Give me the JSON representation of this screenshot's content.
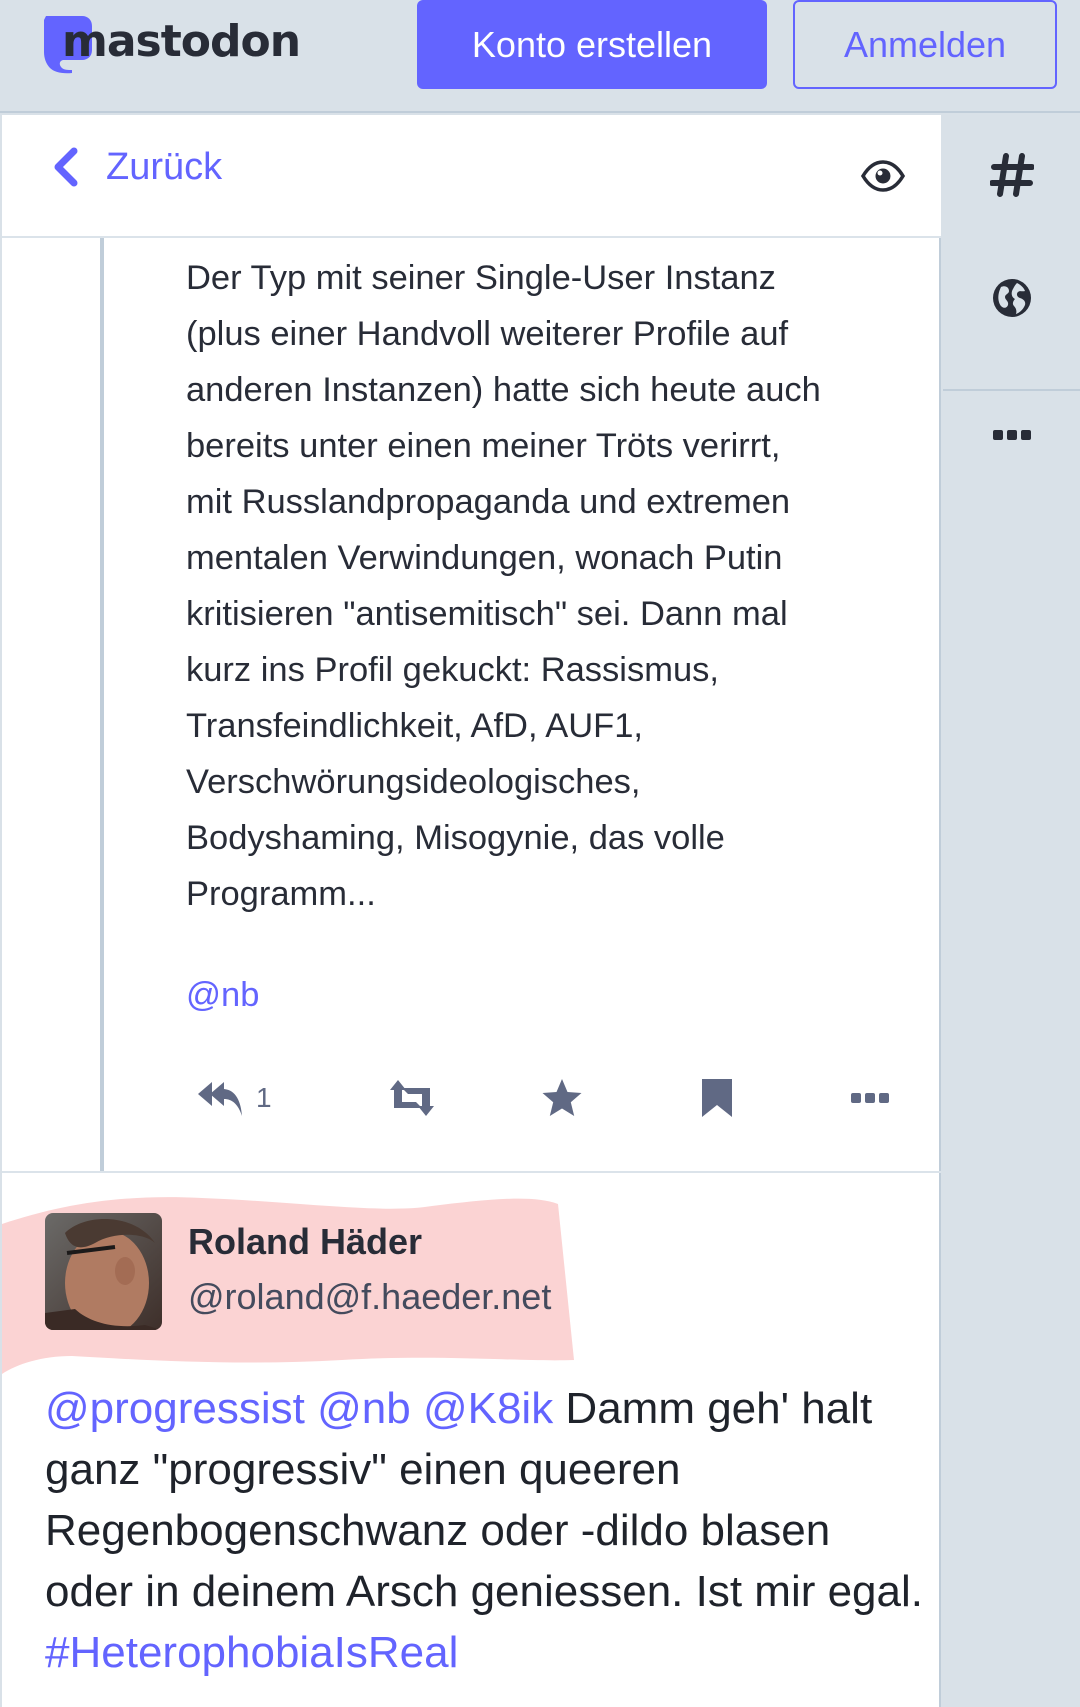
{
  "header": {
    "logo_text": "mastodon",
    "create_account": "Konto erstellen",
    "login": "Anmelden"
  },
  "column": {
    "back_label": "Zurück"
  },
  "ancestor_status": {
    "lines": [
      "Der Typ mit seiner Single-User Instanz",
      "(plus einer Handvoll weiterer Profile auf",
      "anderen Instanzen) hatte sich heute auch",
      "bereits unter einen meiner Tröts verirrt,",
      "mit Russlandpropaganda und extremen",
      "mentalen Verwindungen, wonach Putin",
      "kritisieren \"antisemitisch\" sei. Dann mal",
      "kurz ins Profil gekuckt: Rassismus,",
      "Transfeindlichkeit, AfD, AUF1,",
      "Verschwörungsideologisches,",
      "Bodyshaming, Misogynie, das volle",
      "Programm..."
    ],
    "mention": "@nb",
    "reply_count": "1"
  },
  "focused_status": {
    "display_name": "Roland Häder",
    "acct": "@roland@f.haeder.net",
    "mentions": [
      "@progressist",
      "@nb",
      "@K8ik"
    ],
    "text_part1": " Damm geh' halt ganz \"progressiv\" einen queeren Regenbogenschwanz oder -dildo blasen oder in deinem Arsch geniessen. Ist mir egal. ",
    "hashtag": "#HeterophobiaIsReal"
  },
  "colors": {
    "accent": "#6364ff",
    "background": "#d9e1e8",
    "highlight": "#fbd3d3"
  },
  "icons": [
    "mastodon-logo-icon",
    "chevron-left-icon",
    "eye-icon",
    "reply-all-icon",
    "boost-icon",
    "star-icon",
    "bookmark-icon",
    "more-icon",
    "hashtag-icon",
    "globe-icon"
  ]
}
